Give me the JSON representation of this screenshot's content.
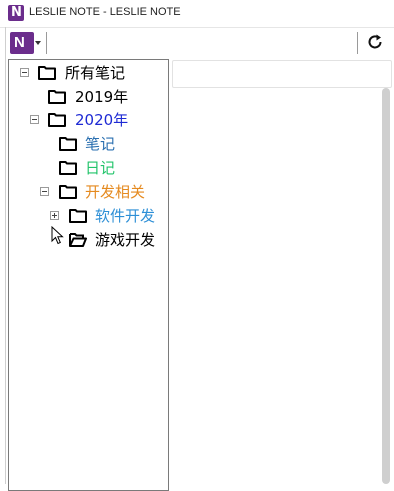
{
  "window": {
    "title": "LESLIE NOTE - LESLIE NOTE"
  },
  "toolbar": {
    "logo_letter": "N",
    "logo_icon": "app-logo-icon",
    "refresh_icon": "refresh-icon",
    "brand_color": "#6b2d8c"
  },
  "tree": {
    "items": [
      {
        "label": "所有笔记",
        "expanded": true,
        "color": "#000000",
        "open_folder": false
      },
      {
        "label": "2019年",
        "color": "#000000",
        "open_folder": false
      },
      {
        "label": "2020年",
        "expanded": true,
        "color": "#1e2ad4",
        "open_folder": false
      },
      {
        "label": "笔记",
        "color": "#2a6fb0",
        "open_folder": false
      },
      {
        "label": "日记",
        "color": "#23c46b",
        "open_folder": false
      },
      {
        "label": "开发相关",
        "expanded": true,
        "color": "#e58a1f",
        "open_folder": false
      },
      {
        "label": "软件开发",
        "expanded": false,
        "color": "#2d8fd6",
        "open_folder": false
      },
      {
        "label": "游戏开发",
        "color": "#000000",
        "open_folder": true
      }
    ]
  }
}
